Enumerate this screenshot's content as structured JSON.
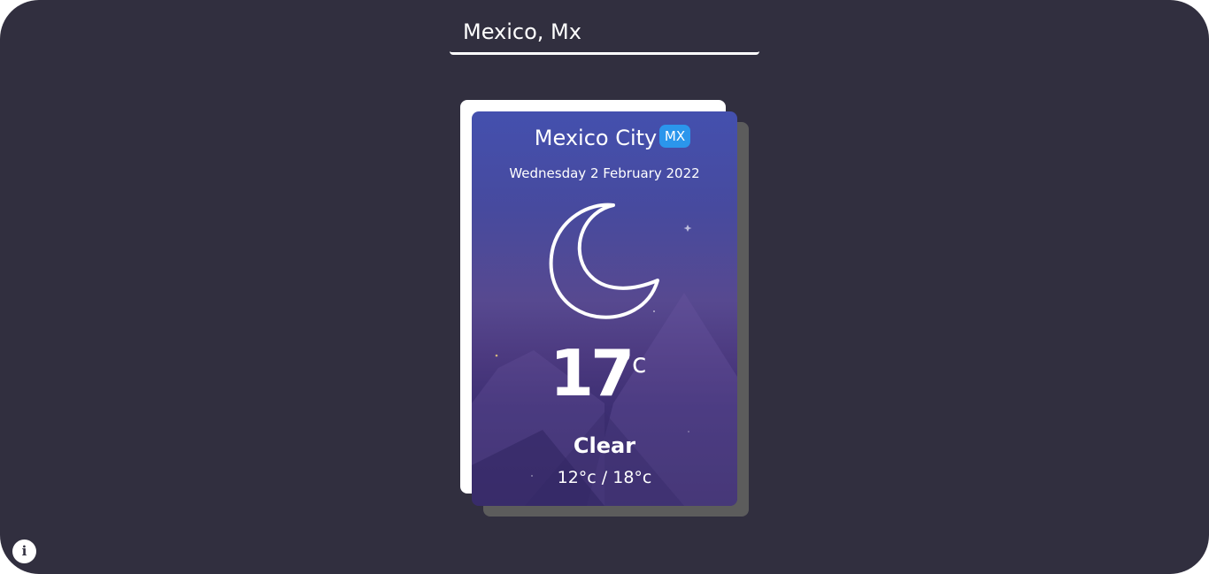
{
  "search": {
    "value": "Mexico, Mx"
  },
  "card": {
    "city": "Mexico City",
    "country_code": "MX",
    "date": "Wednesday 2 February 2022",
    "temperature": "17",
    "unit": "°c",
    "condition": "Clear",
    "range": "12°c / 18°c",
    "weather_icon": "moon-icon"
  },
  "footer": {
    "info_icon": "info-icon",
    "info_glyph": "i"
  },
  "colors": {
    "background": "#312f3f",
    "card_top": "#4450ae",
    "card_bottom": "#342863",
    "badge": "#2b96ec"
  }
}
